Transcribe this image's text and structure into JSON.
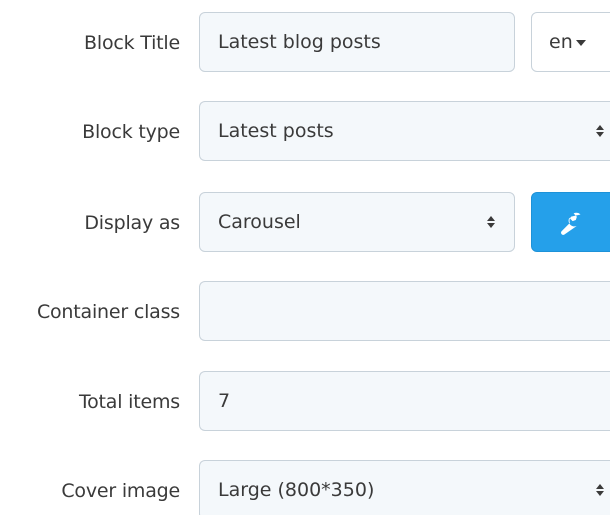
{
  "form": {
    "block_title": {
      "label": "Block Title",
      "value": "Latest blog posts",
      "language": "en"
    },
    "block_type": {
      "label": "Block type",
      "value": "Latest posts"
    },
    "display_as": {
      "label": "Display as",
      "value": "Carousel",
      "settings_icon": "wrench-icon"
    },
    "container_class": {
      "label": "Container class",
      "value": ""
    },
    "total_items": {
      "label": "Total items",
      "value": "7"
    },
    "cover_image": {
      "label": "Cover image",
      "value": "Large (800*350)"
    }
  },
  "colors": {
    "accent": "#25a0ea",
    "field_bg": "#f4f8fb",
    "field_border": "#c8d2da"
  }
}
